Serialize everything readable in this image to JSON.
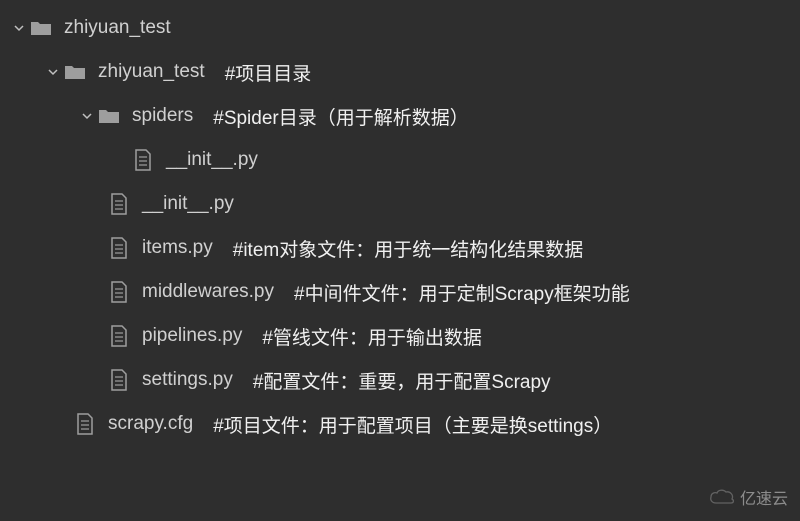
{
  "tree": {
    "root": {
      "name": "zhiyuan_test",
      "children": {
        "project_dir": {
          "name": "zhiyuan_test",
          "comment": "#项目目录",
          "children": {
            "spiders_dir": {
              "name": "spiders",
              "comment": "#Spider目录（用于解析数据）",
              "children": {
                "spiders_init": {
                  "name": "__init__.py"
                }
              }
            },
            "project_init": {
              "name": "__init__.py"
            },
            "items": {
              "name": "items.py",
              "comment": "#item对象文件：用于统一结构化结果数据"
            },
            "middlewares": {
              "name": "middlewares.py",
              "comment": "#中间件文件：用于定制Scrapy框架功能"
            },
            "pipelines": {
              "name": "pipelines.py",
              "comment": "#管线文件：用于输出数据"
            },
            "settings": {
              "name": "settings.py",
              "comment": "#配置文件：重要，用于配置Scrapy"
            }
          }
        },
        "scrapy_cfg": {
          "name": "scrapy.cfg",
          "comment": "#项目文件：用于配置项目（主要是换settings）"
        }
      }
    }
  },
  "watermark": "亿速云"
}
